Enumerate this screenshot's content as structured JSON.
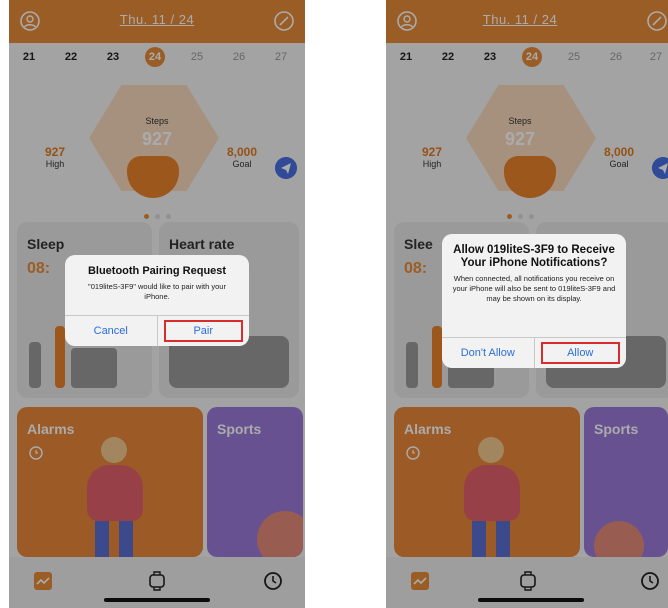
{
  "phones": [
    {
      "header": {
        "date": "Thu. 11 / 24"
      },
      "days": [
        "21",
        "22",
        "23",
        "24",
        "25",
        "26",
        "27"
      ],
      "selected_day": "24",
      "steps": {
        "label": "Steps",
        "value": "927",
        "high_value": "927",
        "high_label": "High",
        "goal_value": "8,000",
        "goal_label": "Goal"
      },
      "cards": {
        "sleep_title": "Sleep",
        "sleep_time": "08:",
        "heart_title": "Heart rate",
        "alarms_title": "Alarms",
        "sports_title": "Sports"
      },
      "dialog": {
        "title": "Bluetooth Pairing Request",
        "message": "\"019liteS-3F9\" would like to pair with your iPhone.",
        "cancel": "Cancel",
        "confirm": "Pair"
      }
    },
    {
      "header": {
        "date": "Thu. 11 / 24"
      },
      "days": [
        "21",
        "22",
        "23",
        "24",
        "25",
        "26",
        "27"
      ],
      "selected_day": "24",
      "steps": {
        "label": "Steps",
        "value": "927",
        "high_value": "927",
        "high_label": "High",
        "goal_value": "8,000",
        "goal_label": "Goal"
      },
      "cards": {
        "sleep_title": "Slee",
        "sleep_time": "08:",
        "heart_title": "",
        "alarms_title": "Alarms",
        "sports_title": "Sports"
      },
      "dialog": {
        "title": "Allow 019liteS-3F9 to Receive Your iPhone Notifications?",
        "message": "When connected, all notifications you receive on your iPhone will also be sent to 019liteS-3F9 and may be shown on its display.",
        "cancel": "Don't Allow",
        "confirm": "Allow"
      }
    }
  ],
  "colors": {
    "accent": "#e88b3a",
    "sports": "#9a7ad8",
    "link_blue": "#2a6edb",
    "highlight_red": "#d92c2c"
  },
  "icons": [
    "profile-icon",
    "edit-icon",
    "send-icon",
    "alarm-clock-icon",
    "activity-chart-icon",
    "watch-face-icon",
    "clock-icon",
    "runner-icon"
  ]
}
